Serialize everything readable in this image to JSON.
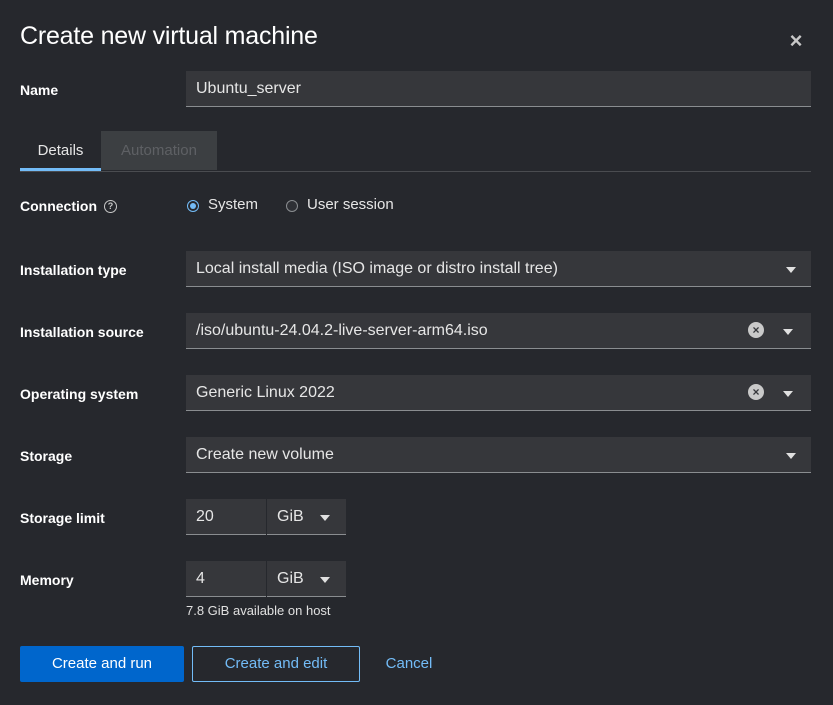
{
  "dialog": {
    "title": "Create new virtual machine",
    "close_icon": "×"
  },
  "name": {
    "label": "Name",
    "value": "Ubuntu_server"
  },
  "tabs": [
    {
      "label": "Details",
      "active": true
    },
    {
      "label": "Automation",
      "active": false,
      "disabled": true
    }
  ],
  "connection": {
    "label": "Connection",
    "help_icon": "?",
    "options": [
      {
        "label": "System",
        "selected": true
      },
      {
        "label": "User session",
        "selected": false
      }
    ]
  },
  "installation_type": {
    "label": "Installation type",
    "value": "Local install media (ISO image or distro install tree)"
  },
  "installation_source": {
    "label": "Installation source",
    "value": "/iso/ubuntu-24.04.2-live-server-arm64.iso"
  },
  "operating_system": {
    "label": "Operating system",
    "value": "Generic Linux 2022"
  },
  "storage": {
    "label": "Storage",
    "value": "Create new volume"
  },
  "storage_limit": {
    "label": "Storage limit",
    "value": "20",
    "unit": "GiB"
  },
  "memory": {
    "label": "Memory",
    "value": "4",
    "unit": "GiB",
    "hint": "7.8 GiB available on host"
  },
  "actions": {
    "create_run": "Create and run",
    "create_edit": "Create and edit",
    "cancel": "Cancel"
  },
  "colors": {
    "background": "#26282d",
    "field": "#36373b",
    "accent": "#73bcf7",
    "primary": "#0066cc"
  }
}
